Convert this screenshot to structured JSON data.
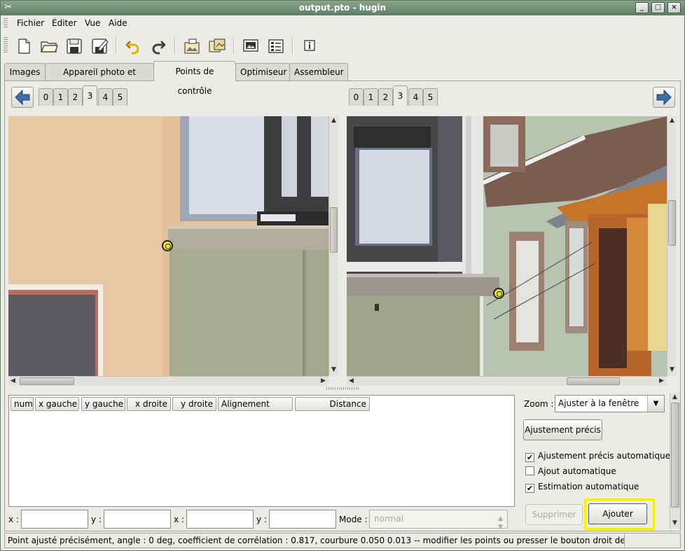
{
  "window": {
    "title": "output.pto - hugin",
    "controls": [
      "_",
      "□",
      "×"
    ]
  },
  "menu": {
    "items": [
      "Fichier",
      "Éditer",
      "Vue",
      "Aide"
    ]
  },
  "toolbar": {
    "buttons": [
      "new-file",
      "open-folder",
      "save",
      "save-as",
      "undo",
      "redo",
      "add-images",
      "optimize",
      "preview",
      "batch",
      "info"
    ]
  },
  "tabs": {
    "items": [
      "Images",
      "Appareil photo et objectif",
      "Points de contrôle",
      "Optimiseur",
      "Assembleur"
    ],
    "active": "Points de contrôle"
  },
  "left_view": {
    "image_tabs": [
      "0",
      "1",
      "2",
      "3",
      "4",
      "5"
    ],
    "selected": "3"
  },
  "right_view": {
    "image_tabs": [
      "0",
      "1",
      "2",
      "3",
      "4",
      "5"
    ],
    "selected": "3"
  },
  "table": {
    "columns": [
      "numé",
      "x gauche",
      "y gauche",
      "x droite",
      "y droite",
      "Alignement",
      "Distance"
    ],
    "rows": []
  },
  "coords": {
    "x_label": "x :",
    "y_label": "y :",
    "x2_label": "x :",
    "y2_label": "y :",
    "mode_label": "Mode :",
    "mode_value": "normal"
  },
  "right_panel": {
    "zoom_label": "Zoom :",
    "zoom_value": "Ajuster à la fenêtre",
    "fine_tune_button": "Ajustement précis",
    "auto_fine_tune": {
      "label": "Ajustement précis automatique",
      "checked": true
    },
    "auto_add": {
      "label": "Ajout automatique",
      "checked": false
    },
    "auto_estimate": {
      "label": "Estimation automatique",
      "checked": true
    },
    "delete_button": "Supprimer",
    "add_button": "Ajouter"
  },
  "status": {
    "text": "Point ajusté précisément, angle : 0 deg, coefficient de corrélation : 0.817, courbure 0.050 0.013 -- modifier les points ou presser le bouton droit de la souris"
  },
  "colors": {
    "titlebar": "#6d8b71",
    "highlight": "#f2f200",
    "control_point": "#ebeb28"
  }
}
